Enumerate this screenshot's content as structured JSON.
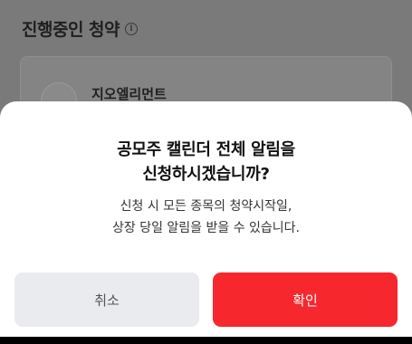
{
  "background": {
    "section_title": "진행중인 청약",
    "info_icon": "i",
    "company_name": "지오엘리먼트"
  },
  "dialog": {
    "title_line1": "공모주 캘린더 전체 알림을",
    "title_line2": "신청하시겠습니까?",
    "description_line1": "신청 시 모든 종목의 청약시작일,",
    "description_line2": "상장 당일 알림을 받을 수 있습니다.",
    "cancel_label": "취소",
    "confirm_label": "확인"
  },
  "colors": {
    "confirm": "#f6272d",
    "cancel": "#e9ebee",
    "overlay": "#7a7a7a"
  }
}
